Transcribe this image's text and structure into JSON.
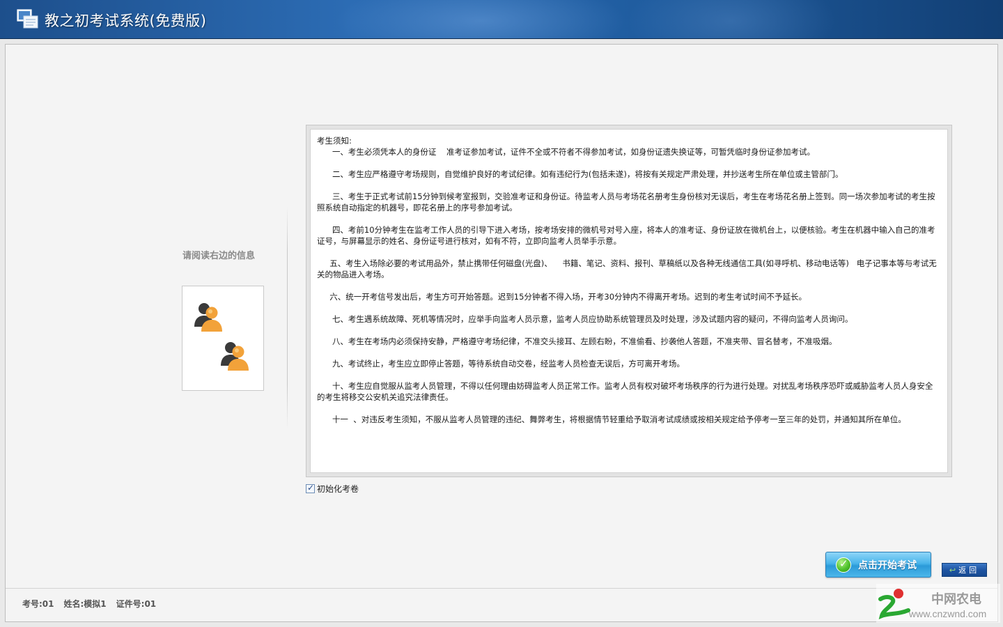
{
  "window": {
    "title": "教之初考试系统(免费版)"
  },
  "left": {
    "prompt": "请阅读右边的信息"
  },
  "notice": {
    "heading": "考生须知:",
    "paragraphs": [
      "      一、考生必须凭本人的身份证    准考证参加考试，证件不全或不符者不得参加考试，如身份证遗失换证等，可暂凭临时身份证参加考试。",
      "      二、考生应严格遵守考场规则，自觉维护良好的考试纪律。如有违纪行为(包括未遂)，将按有关规定严肃处理，并抄送考生所在单位或主管部门。",
      "      三、考生于正式考试前15分钟到候考室报到，交验准考证和身份证。待监考人员与考场花名册考生身份核对无误后，考生在考场花名册上签到。同一场次参加考试的考生按照系统自动指定的机器号，即花名册上的序号参加考试。",
      "      四、考前10分钟考生在监考工作人员的引导下进入考场，按考场安排的微机号对号入座，将本人的准考证、身份证放在微机台上，以便核验。考生在机器中输入自己的准考证号，与屏幕显示的姓名、身份证号进行核对，如有不符，立即向监考人员举手示意。",
      "     五、考生入场除必要的考试用品外，禁止携带任何磁盘(光盘)、    书籍、笔记、资料、报刊、草稿纸以及各种无线通信工具(如寻呼机、移动电话等)   电子记事本等与考试无关的物品进入考场。",
      "     六、统一开考信号发出后，考生方可开始答题。迟到15分钟者不得入场，开考30分钟内不得离开考场。迟到的考生考试时间不予延长。",
      "      七、考生遇系统故障、死机等情况时，应举手向监考人员示意，监考人员应协助系统管理员及时处理，涉及试题内容的疑问，不得向监考人员询问。",
      "      八、考生在考场内必须保持安静，严格遵守考场纪律，不准交头接耳、左顾右盼，不准偷看、抄袭他人答题，不准夹带、冒名替考，不准吸烟。",
      "      九、考试终止，考生应立即停止答题，等待系统自动交卷，经监考人员检查无误后，方可离开考场。",
      "      十、考生应自觉服从监考人员管理，不得以任何理由妨碍监考人员正常工作。监考人员有权对破坏考场秩序的行为进行处理。对扰乱考场秩序恐吓或威胁监考人员人身安全的考生将移交公安机关追究法律责任。",
      "      十一  、对违反考生须知，不服从监考人员管理的违纪、舞弊考生，将根据情节轻重给予取消考试成绩或按相关规定给予停考一至三年的处罚，并通知其所在单位。"
    ]
  },
  "options": {
    "init_paper_label": "初始化考卷",
    "init_paper_checked": true
  },
  "buttons": {
    "start_exam": "点击开始考试",
    "back": "返回"
  },
  "footer": {
    "exam_no": "考号:01",
    "name": "姓名:模拟1",
    "id_no": "证件号:01"
  },
  "watermark": {
    "name": "中网农电",
    "url": "www.cnzwnd.com"
  },
  "colors": {
    "titlebar": "#1d4f8c",
    "start_button": "#49b4ea",
    "back_button": "#1f55a3"
  }
}
